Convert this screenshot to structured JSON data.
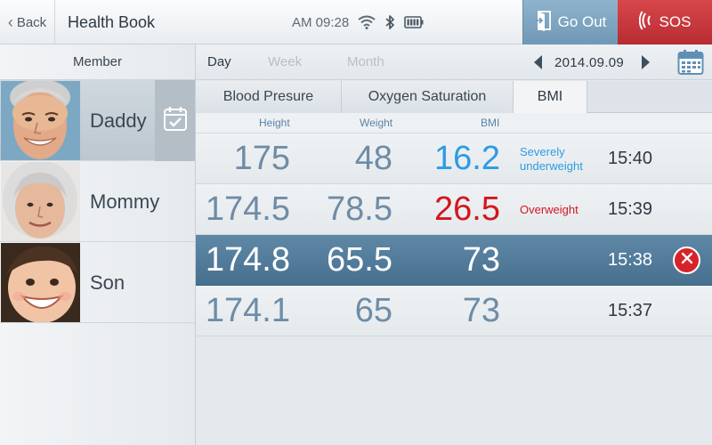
{
  "header": {
    "back_label": "Back",
    "title": "Health Book",
    "time": "AM 09:28",
    "go_out_label": "Go Out",
    "sos_label": "SOS"
  },
  "sidebar": {
    "header": "Member",
    "members": [
      {
        "name": "Daddy",
        "active": true
      },
      {
        "name": "Mommy",
        "active": false
      },
      {
        "name": "Son",
        "active": false
      }
    ]
  },
  "period": {
    "options": [
      "Day",
      "Week",
      "Month"
    ],
    "selected": "Day",
    "date": "2014.09.09"
  },
  "tabs": [
    {
      "label": "Blood Presure",
      "active": false
    },
    {
      "label": "Oxygen Saturation",
      "active": false
    },
    {
      "label": "BMI",
      "active": true
    }
  ],
  "table": {
    "headers": {
      "height": "Height",
      "weight": "Weight",
      "bmi": "BMI"
    },
    "rows": [
      {
        "height": "175",
        "weight": "48",
        "bmi": "16.2",
        "status": "Severely underweight",
        "time": "15:40",
        "bmi_color": "#2e9be3",
        "status_color": "#2e9be3",
        "selected": false
      },
      {
        "height": "174.5",
        "weight": "78.5",
        "bmi": "26.5",
        "status": "Overweight",
        "time": "15:39",
        "bmi_color": "#d4161f",
        "status_color": "#d4161f",
        "selected": false
      },
      {
        "height": "174.8",
        "weight": "65.5",
        "bmi": "73",
        "status": "",
        "time": "15:38",
        "bmi_color": "#ffffff",
        "status_color": "#ffffff",
        "selected": true
      },
      {
        "height": "174.1",
        "weight": "65",
        "bmi": "73",
        "status": "",
        "time": "15:37",
        "bmi_color": "#6f8ca6",
        "status_color": "#6f8ca6",
        "selected": false
      }
    ]
  },
  "colors": {
    "accent": "#4a7394",
    "sos": "#c8383d",
    "go_out": "#7fa4c0",
    "underweight": "#2e9be3",
    "overweight": "#d4161f"
  },
  "icons": {
    "wifi": "wifi-icon",
    "bluetooth": "bluetooth-icon",
    "battery": "battery-icon",
    "go_out": "exit-door-icon",
    "sos": "signal-waves-icon",
    "calendar": "calendar-icon",
    "delete": "close-icon"
  }
}
